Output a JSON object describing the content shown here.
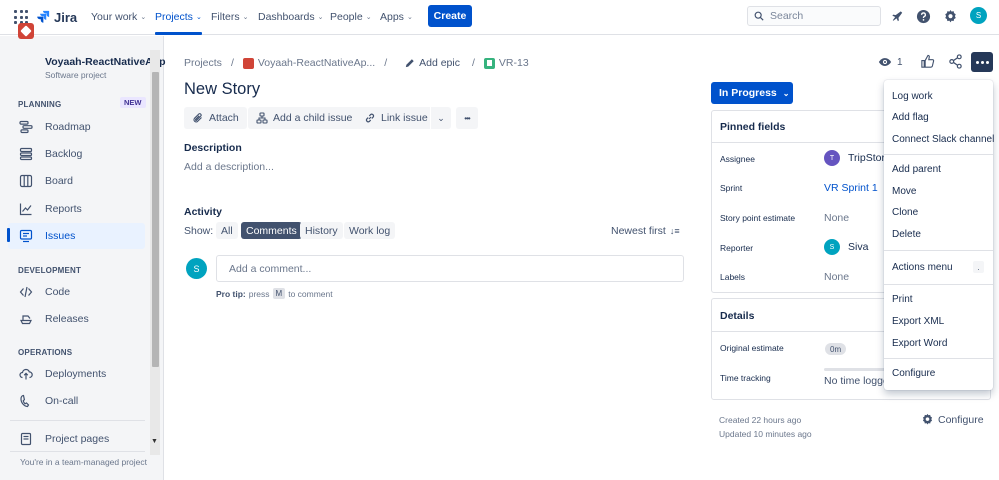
{
  "topnav": {
    "product": "Jira",
    "items": [
      {
        "label": "Your work",
        "chevron": "⌄"
      },
      {
        "label": "Projects",
        "chevron": "⌄"
      },
      {
        "label": "Filters",
        "chevron": "⌄"
      },
      {
        "label": "Dashboards",
        "chevron": "⌄"
      },
      {
        "label": "People",
        "chevron": "⌄"
      },
      {
        "label": "Apps",
        "chevron": "⌄"
      }
    ],
    "create_label": "Create",
    "search_placeholder": "Search",
    "avatar_initial": "S"
  },
  "sidebar": {
    "project_name": "Voyaah-ReactNativeApp",
    "project_type": "Software project",
    "planning": {
      "heading": "PLANNING",
      "badge": "NEW",
      "items": [
        {
          "label": "Roadmap"
        },
        {
          "label": "Backlog"
        },
        {
          "label": "Board"
        },
        {
          "label": "Reports"
        },
        {
          "label": "Issues"
        }
      ]
    },
    "development": {
      "heading": "DEVELOPMENT",
      "items": [
        {
          "label": "Code"
        },
        {
          "label": "Releases"
        }
      ]
    },
    "operations": {
      "heading": "OPERATIONS",
      "items": [
        {
          "label": "Deployments"
        },
        {
          "label": "On-call"
        }
      ]
    },
    "project_pages": "Project pages",
    "team_note": "You're in a team-managed project"
  },
  "breadcrumb": {
    "projects": "Projects",
    "sep": "/",
    "project": "Voyaah-ReactNativeAp...",
    "add_epic": "Add epic",
    "issue_key": "VR-13"
  },
  "issue": {
    "title": "New Story",
    "actions": {
      "attach": "Attach",
      "add_child": "Add a child issue",
      "link": "Link issue",
      "chevron": "⌄",
      "more": "•••"
    },
    "description_heading": "Description",
    "description_placeholder": "Add a description...",
    "activity": {
      "heading": "Activity",
      "show_label": "Show:",
      "filters": [
        "All",
        "Comments",
        "History",
        "Work log"
      ],
      "sort": "Newest first",
      "sort_icon": "↓≡",
      "comment_placeholder": "Add a comment...",
      "commenter_initial": "S",
      "protip_bold": "Pro tip:",
      "protip_pre": "press",
      "protip_key": "M",
      "protip_post": "to comment"
    }
  },
  "header_actions": {
    "watch_count": "1"
  },
  "status": {
    "label": "In Progress",
    "chevron": "⌄"
  },
  "pinned": {
    "heading": "Pinned fields",
    "fields": [
      {
        "label": "Assignee",
        "value": "TripStoric",
        "initial": "T",
        "color": "#6554c0"
      },
      {
        "label": "Sprint",
        "value": "VR Sprint 1"
      },
      {
        "label": "Story point estimate",
        "value": "None"
      },
      {
        "label": "Reporter",
        "value": "Siva",
        "initial": "S",
        "color": "#00a3bf"
      },
      {
        "label": "Labels",
        "value": "None"
      }
    ]
  },
  "details": {
    "heading": "Details",
    "original_estimate_label": "Original estimate",
    "original_estimate_value": "0m",
    "time_tracking_label": "Time tracking",
    "time_tracking_value": "No time logge"
  },
  "meta": {
    "created": "Created 22 hours ago",
    "updated": "Updated 10 minutes ago",
    "configure": "Configure"
  },
  "menu": {
    "items": [
      "Log work",
      "Add flag",
      "Connect Slack channel",
      "Add parent",
      "Move",
      "Clone",
      "Delete",
      "Actions menu",
      "Print",
      "Export XML",
      "Export Word",
      "Configure"
    ],
    "actions_shortcut": "."
  },
  "colors": {
    "brand": "#0052cc",
    "more_button": "#253858",
    "project_icon": "#d04437"
  }
}
